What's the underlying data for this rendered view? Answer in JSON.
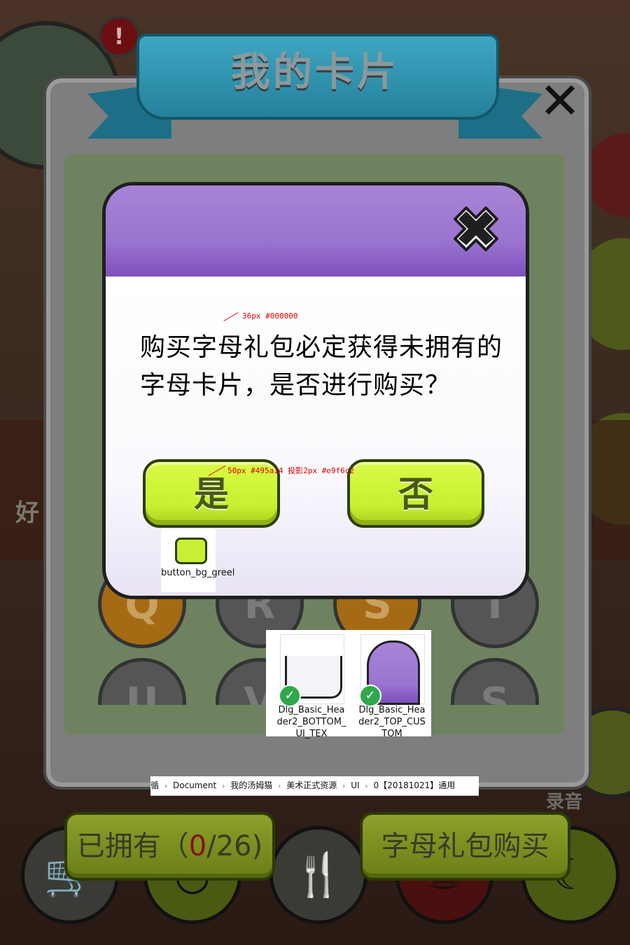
{
  "panel": {
    "title": "我的卡片",
    "close_icon": "close-icon",
    "letters": [
      "Q",
      "R",
      "S",
      "T",
      "U",
      "V",
      "S"
    ]
  },
  "background": {
    "alert_glyph": "!",
    "side_text": "好",
    "record_label": "录音"
  },
  "bottom_bar": {
    "owned_prefix": "已拥有（",
    "owned_count": "0",
    "owned_suffix": "/26)",
    "buy_label": "字母礼包购买",
    "icons": [
      "cart-icon",
      "smile-icon",
      "fork-spoon-icon",
      "food-icon",
      "moon-icon"
    ]
  },
  "dialog": {
    "message": "购买字母礼包必定获得未拥有的字母卡片，是否进行购买？",
    "yes_label": "是",
    "no_label": "否",
    "colors": {
      "header": "#9a74d0",
      "button": "#c6f031",
      "button_text": "#495a14"
    }
  },
  "annotations": {
    "text_spec": "36px #000000",
    "button_spec": "50px #495a14 投影2px #e9f6c2"
  },
  "assets": {
    "button": "button_bg_greel",
    "bottom": "Dlg_Basic_Header2_BOTTOM_UI_TEX",
    "top": "Dlg_Basic_Header2_TOP_CUSTOM"
  },
  "breadcrumb": {
    "items": [
      "Document",
      "我的汤姆猫",
      "美术正式资源",
      "UI",
      "0【20181021】通用"
    ],
    "lead_fragment": "循"
  }
}
